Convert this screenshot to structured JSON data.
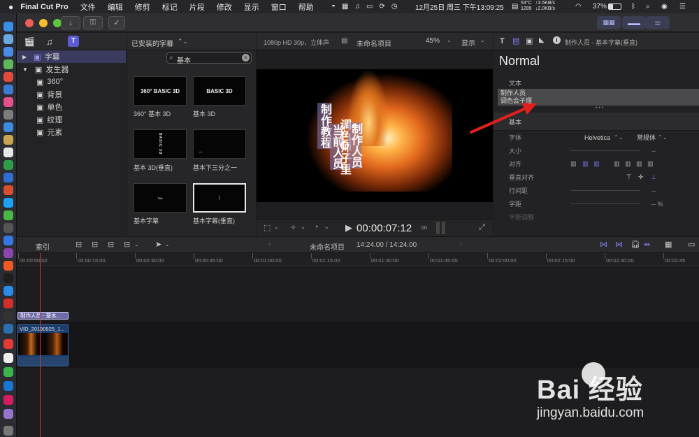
{
  "menubar": {
    "app": "Final Cut Pro",
    "items": [
      "文件",
      "编辑",
      "修剪",
      "标记",
      "片段",
      "修改",
      "显示",
      "窗口",
      "帮助"
    ],
    "cpu_temp": "53°C",
    "cpu_rpm": "1289",
    "net_up": "↑3.5KB/s",
    "net_down": "↓2.0KB/s",
    "clock": "12月25日 周三 下午13:09:25",
    "battery": "37%"
  },
  "browser": {
    "library_tree": [
      {
        "label": "字幕",
        "type": "category",
        "selected": true
      },
      {
        "label": "发生器",
        "type": "category"
      },
      {
        "label": "360°",
        "type": "item"
      },
      {
        "label": "背景",
        "type": "item"
      },
      {
        "label": "单色",
        "type": "item"
      },
      {
        "label": "纹理",
        "type": "item"
      },
      {
        "label": "元素",
        "type": "item"
      }
    ],
    "installed_title": "已安装的字幕",
    "search_value": "基本",
    "thumbnails": [
      {
        "label": "360° 基本 3D",
        "preview": "360° BASIC 3D"
      },
      {
        "label": "基本 3D",
        "preview": "BASIC 3D"
      },
      {
        "label": "基本 3D(垂直)",
        "preview": "BASIC 3D"
      },
      {
        "label": "基本下三分之一",
        "preview": "..."
      },
      {
        "label": "基本字幕",
        "preview": "Title"
      },
      {
        "label": "基本字幕(垂直)",
        "preview": "|"
      }
    ]
  },
  "viewer": {
    "format": "1080p HD 30p，立体声",
    "project": "未命名项目",
    "zoom": "45%",
    "display": "显示",
    "timecode": "00:00:07:12",
    "frames": "00",
    "texts": [
      "制作教程",
      "当前人员",
      "调色师子里",
      "制作人员"
    ]
  },
  "inspector": {
    "title": "制作人员 - 基本字幕(垂直)",
    "preset": "Normal",
    "section_text": "文本",
    "text_value_1": "制作人员",
    "text_value_2": "调色会子理",
    "section_basic": "基本",
    "rows": [
      {
        "label": "字体",
        "value": "Helvetica",
        "value2": "常规体"
      },
      {
        "label": "大小",
        "value": "--"
      },
      {
        "label": "对齐",
        "value": ""
      },
      {
        "label": "垂直对齐",
        "value": ""
      },
      {
        "label": "行间距",
        "value": "--"
      },
      {
        "label": "字距",
        "value": "-- %"
      },
      {
        "label": "字距调整",
        "value": ""
      }
    ]
  },
  "timeline": {
    "index_label": "索引",
    "project": "未命名项目",
    "duration": "14:24.00 / 14:24.00",
    "timecodes": [
      "00:00:00:00",
      "00:00:15:00",
      "00:00:30:00",
      "00:00:45:00",
      "00:01:00:00",
      "00:01:15:00",
      "00:01:30:00",
      "00:01:45:00",
      "00:02:00:00",
      "00:02:15:00",
      "00:02:30:00",
      "00:02:45"
    ],
    "title_clip": "制作人员 - 基本...",
    "video_clip": "VID_20190925_1..."
  },
  "watermark": {
    "brand": "Bai 经验",
    "url": "jingyan.baidu.com"
  },
  "colors": {
    "accent": "#6b6cd8",
    "playhead": "#d23a3a",
    "arrow": "#e0201b",
    "title_clip": "#6e6aa6",
    "video_clip": "#1b3e6e"
  }
}
